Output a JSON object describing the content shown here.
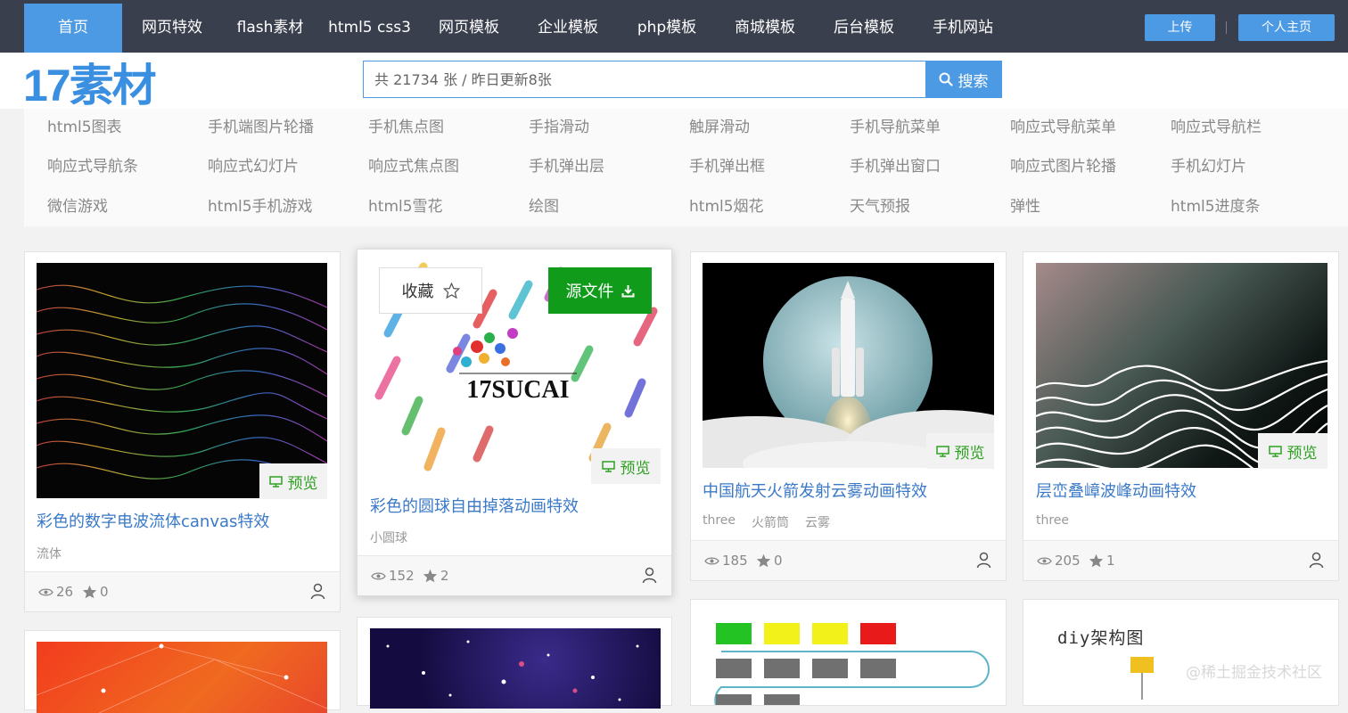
{
  "nav": {
    "items": [
      "首页",
      "网页特效",
      "flash素材",
      "html5 css3",
      "网页模板",
      "企业模板",
      "php模板",
      "商城模板",
      "后台模板",
      "手机网站"
    ],
    "upload": "上传",
    "profile": "个人主页"
  },
  "logo": "17素材",
  "search": {
    "placeholder": "共 21734 张 / 昨日更新8张",
    "button": "搜索"
  },
  "tags": [
    [
      "html5图表",
      "手机端图片轮播",
      "手机焦点图",
      "手指滑动",
      "触屏滑动",
      "手机导航菜单",
      "响应式导航菜单",
      "响应式导航栏"
    ],
    [
      "响应式导航条",
      "响应式幻灯片",
      "响应式焦点图",
      "手机弹出层",
      "手机弹出框",
      "手机弹出窗口",
      "响应式图片轮播",
      "手机幻灯片"
    ],
    [
      "微信游戏",
      "html5手机游戏",
      "html5雪花",
      "绘图",
      "html5烟花",
      "天气预报",
      "弹性",
      "html5进度条"
    ]
  ],
  "cards": [
    {
      "title": "彩色的数字电波流体canvas特效",
      "tags": [
        "流体"
      ],
      "views": "26",
      "stars": "0",
      "preview": "预览"
    },
    {
      "title": "彩色的圆球自由掉落动画特效",
      "tags": [
        "小圆球"
      ],
      "views": "152",
      "stars": "2",
      "preview": "预览",
      "fav": "收藏",
      "source": "源文件",
      "image_text": "17SUCAI"
    },
    {
      "title": "中国航天火箭发射云雾动画特效",
      "tags": [
        "three",
        "火箭筒",
        "云雾"
      ],
      "views": "185",
      "stars": "0",
      "preview": "预览"
    },
    {
      "title": "层峦叠嶂波峰动画特效",
      "tags": [
        "three"
      ],
      "views": "205",
      "stars": "1",
      "preview": "预览"
    }
  ],
  "bottom": {
    "diy_title": "diy架构图"
  },
  "watermark": "@稀土掘金技术社区",
  "colors": {
    "nav_bg": "#3a3f4d",
    "accent": "#4c99e4",
    "link": "#3a79c8",
    "preview_green": "#2ea121",
    "source_green": "#109b1b"
  }
}
